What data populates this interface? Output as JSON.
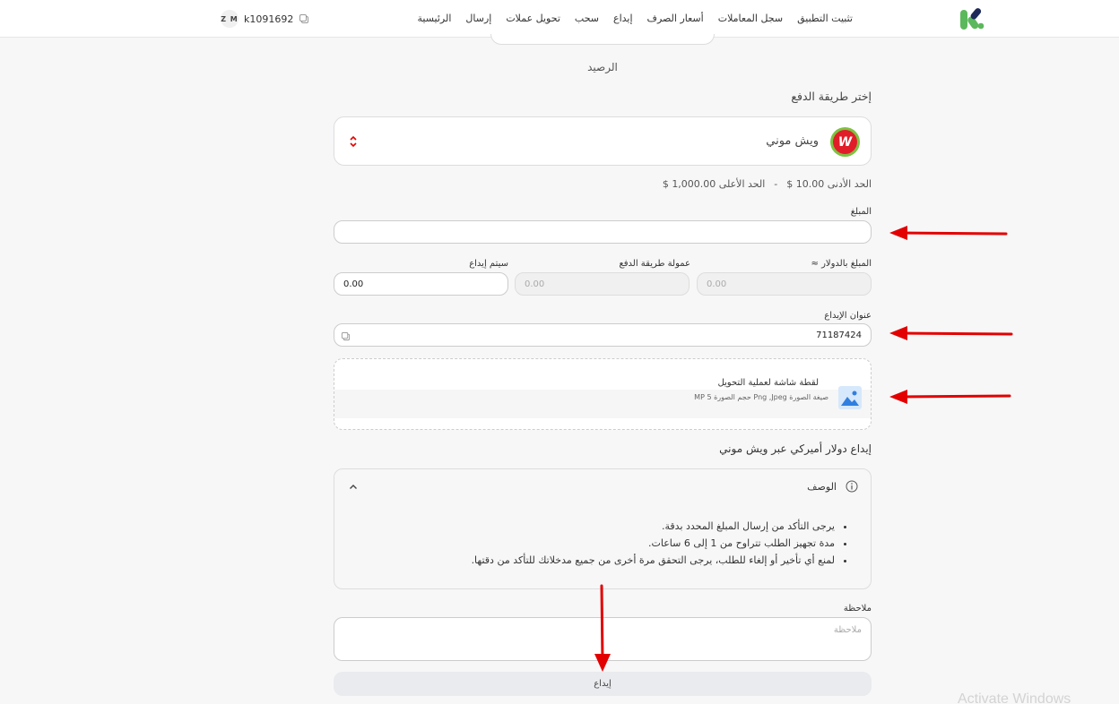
{
  "header": {
    "nav": [
      "الرئيسية",
      "إرسال",
      "تحويل عملات",
      "سحب",
      "إيداع",
      "أسعار الصرف",
      "سجل المعاملات",
      "تثبيت التطبيق"
    ],
    "avatar_initials": "Z M",
    "account_id": "k1091692",
    "brand_colors": {
      "green": "#5cb85c",
      "navy": "#1f2a5a"
    }
  },
  "form": {
    "balance_label": "الرصيد",
    "choose_method_label": "إختر طريقة الدفع",
    "method": {
      "name": "ويش موني",
      "logo_letter": "W",
      "logo_colors": {
        "ring": "#7dc242",
        "fill": "#e11d2a"
      }
    },
    "limits": {
      "min": "الحد الأدنى 10.00 $",
      "separator": "-",
      "max": "الحد الأعلى 1,000.00 $"
    },
    "amount": {
      "label": "المبلغ",
      "value": ""
    },
    "usd_amount": {
      "label": "المبلغ بالدولار ≈",
      "value": "0.00"
    },
    "commission": {
      "label": "عمولة طريقة الدفع",
      "value": "0.00"
    },
    "will_deposit": {
      "label": "سيتم إيداع",
      "value": "0.00"
    },
    "address": {
      "label": "عنوان الإيداع",
      "value": "71187424"
    },
    "upload": {
      "title": "لقطة شاشة لعملية التحويل",
      "hint": "صيغة الصورة Png ,Jpeg حجم الصورة 5 MP"
    },
    "deposit_title": "إيداع دولار أميركي عبر ويش موني",
    "description": {
      "title": "الوصف",
      "items": [
        "يرجى التأكد من إرسال المبلغ المحدد بدقة.",
        "مدة تجهيز الطلب تتراوح من 1 إلى 6 ساعات.",
        "لمنع أي تأخير أو إلغاء للطلب، يرجى التحقق مرة أخرى من جميع مدخلاتك للتأكد من دقتها."
      ]
    },
    "note": {
      "label": "ملاحظة",
      "placeholder": "ملاحظة"
    },
    "submit_label": "إيداع"
  },
  "annotation_color": "#e30000",
  "watermark": "Activate Windows"
}
